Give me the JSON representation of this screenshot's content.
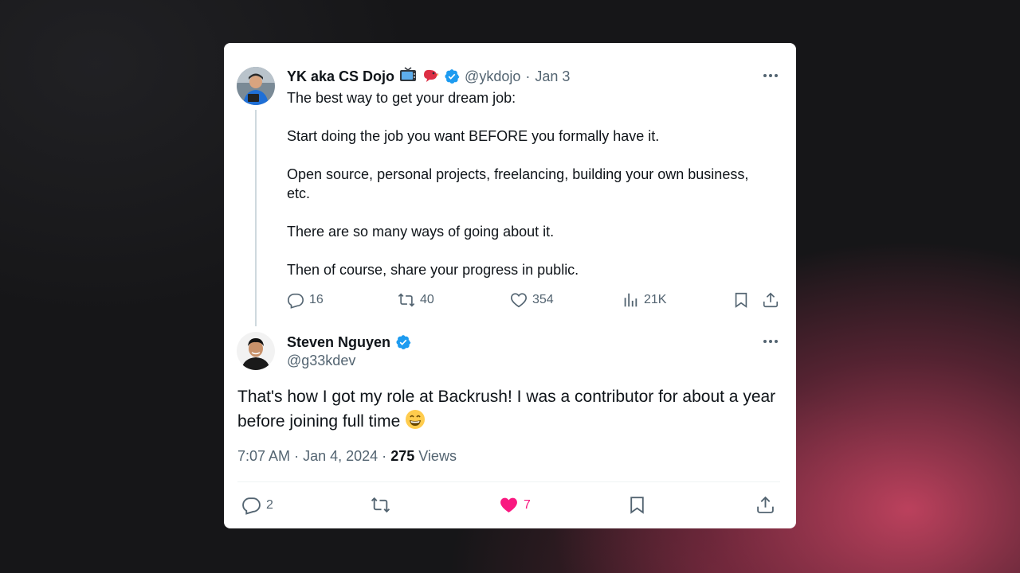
{
  "original": {
    "author_name": "YK aka CS Dojo",
    "handle": "@ykdojo",
    "separator": "·",
    "date": "Jan 3",
    "badges": [
      "tv-emoji",
      "red-bird-emoji",
      "verified-icon"
    ],
    "lines": [
      "The best way to get your dream job:",
      "Start doing the job you want BEFORE you formally have it.",
      "Open source, personal projects, freelancing, building your own business,",
      "etc.",
      "There are so many ways of going about it.",
      "Then of course, share your progress in public."
    ],
    "stats": {
      "replies": "16",
      "retweets": "40",
      "likes": "354",
      "views": "21K"
    }
  },
  "reply": {
    "author_name": "Steven Nguyen",
    "handle": "@g33kdev",
    "line1_before": "That's how I got my role at ",
    "mention": "Backrush!",
    "line1_after": " I was a contributor for about a year",
    "line2": "before joining full time",
    "emoji": "😁",
    "time": "7:07 AM",
    "sep": "·",
    "date": "Jan 4, 2024",
    "views_count": "275",
    "views_label": "Views",
    "stats": {
      "replies": "2",
      "likes": "7"
    }
  },
  "colors": {
    "verified": "#1d9bf0",
    "like_active": "#f91880",
    "muted": "#536471",
    "text": "#0f1419"
  }
}
